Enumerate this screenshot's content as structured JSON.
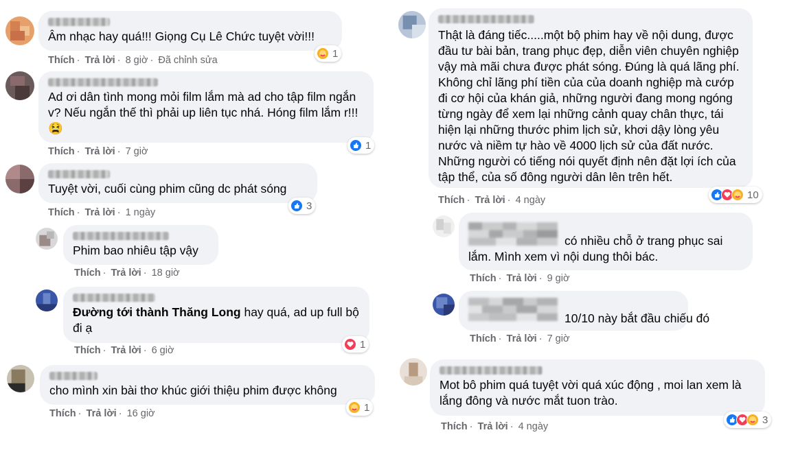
{
  "left": [
    {
      "text": "Âm nhạc hay quá!!! Giọng Cụ Lê Chức tuyệt vời!!!",
      "actions": {
        "like": "Thích",
        "reply": "Trả lời",
        "time": "8 giờ",
        "edited": "Đã chỉnh sửa"
      },
      "reactions": {
        "types": [
          "care"
        ],
        "count": "1"
      }
    },
    {
      "text": "Ad ơi dân tình mong mỏi film lắm mà ad cho tập film ngắn v? Nếu ngắn thế thì phải up liên tục nhá. Hóng film lắm r!!! 😫",
      "actions": {
        "like": "Thích",
        "reply": "Trả lời",
        "time": "7 giờ"
      },
      "reactions": {
        "types": [
          "like"
        ],
        "count": "1"
      }
    },
    {
      "text": "Tuyệt vời, cuối cùng phim cũng dc phát sóng",
      "actions": {
        "like": "Thích",
        "reply": "Trả lời",
        "time": "1 ngày"
      },
      "reactions": {
        "types": [
          "like"
        ],
        "count": "3"
      }
    },
    {
      "text": "Phim bao nhiêu tập vậy",
      "actions": {
        "like": "Thích",
        "reply": "Trả lời",
        "time": "18 giờ"
      }
    },
    {
      "bold": "Đường tới thành Thăng Long",
      "text": " hay quá, ad up full bộ đi ạ",
      "actions": {
        "like": "Thích",
        "reply": "Trả lời",
        "time": "6 giờ"
      },
      "reactions": {
        "types": [
          "love"
        ],
        "count": "1"
      }
    },
    {
      "text": "cho mình xin bài thơ khúc giới thiệu phim được không",
      "actions": {
        "like": "Thích",
        "reply": "Trả lời",
        "time": "16 giờ"
      },
      "reactions": {
        "types": [
          "care"
        ],
        "count": "1"
      }
    }
  ],
  "right": [
    {
      "text": "Thật là đáng tiếc.....một bộ phim hay về nội dung, được đầu tư bài bản, trang phục đẹp, diễn viên chuyên nghiệp vậy mà mãi chưa được phát sóng. Đúng là quá lãng phí. Không chỉ lãng phí tiền của của doanh nghiệp mà cướp đi cơ hội của khán giả, những người đang mong ngóng từng ngày để xem lại những cảnh quay chân thực, tái hiện lại những thước phim lịch sử, khơi dậy lòng yêu nước và niềm tự hào về 4000 lịch sử của đất nước. Những người có tiếng nói quyết định nên đặt lợi ích của tập thể, của số đông người dân lên trên hết.",
      "actions": {
        "like": "Thích",
        "reply": "Trả lời",
        "time": "4 ngày"
      },
      "reactions": {
        "types": [
          "like",
          "love",
          "care"
        ],
        "count": "10"
      }
    },
    {
      "text": "có nhiều chỗ ở trang phục sai lắm. Mình xem vì nội dung thôi bác.",
      "actions": {
        "like": "Thích",
        "reply": "Trả lời",
        "time": "9 giờ"
      }
    },
    {
      "text": "10/10 này bắt đầu chiếu đó",
      "actions": {
        "like": "Thích",
        "reply": "Trả lời",
        "time": "7 giờ"
      }
    },
    {
      "text": "Mot bô phim quá tuyệt vời quá xúc động , moi lan xem là lắng đông và nước mắt tuon trào.",
      "actions": {
        "like": "Thích",
        "reply": "Trả lời",
        "time": "4 ngày"
      },
      "reactions": {
        "types": [
          "like",
          "love",
          "care"
        ],
        "count": "3"
      }
    }
  ],
  "colors": {
    "like": "#1877f2",
    "love": "#f33e58",
    "care": "#f7b125",
    "bubble": "#f0f2f5",
    "meta": "#65676b"
  }
}
